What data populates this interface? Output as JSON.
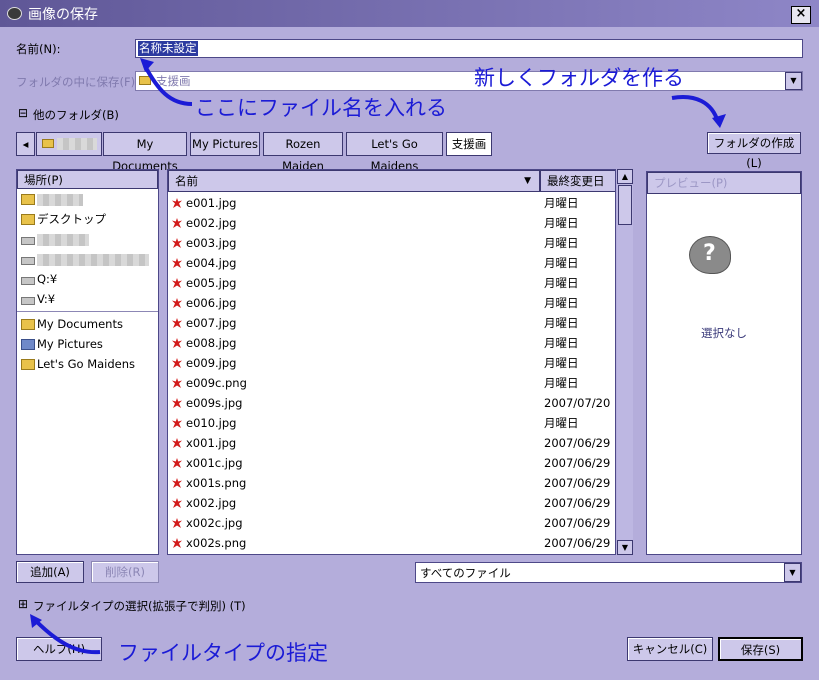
{
  "window": {
    "title": "画像の保存",
    "close": "×"
  },
  "name_row": {
    "label": "名前(N):",
    "value": "名称未設定"
  },
  "save_in": {
    "label": "フォルダの中に保存(F):",
    "value": "支援画"
  },
  "other_folders": {
    "toggle": "⊟",
    "label": "他のフォルダ(B)"
  },
  "breadcrumb": {
    "back": "◂",
    "items": [
      "My Documents",
      "My Pictures",
      "Rozen Maiden",
      "Let's Go Maidens",
      "支援画"
    ]
  },
  "create_folder_button": "フォルダの作成(L)",
  "places": {
    "header": "場所(P)",
    "items": [
      {
        "label": "",
        "icon": "folder-icon"
      },
      {
        "label": "デスクトップ",
        "icon": "folder-icon"
      },
      {
        "label": "",
        "icon": "drive-icon"
      },
      {
        "label": "",
        "icon": "drive-icon"
      },
      {
        "label": "Q:¥",
        "icon": "drive-icon"
      },
      {
        "label": "V:¥",
        "icon": "drive-icon"
      }
    ],
    "bookmarks": [
      {
        "label": "My Documents",
        "icon": "folder-icon"
      },
      {
        "label": "My Pictures",
        "icon": "pictures-folder-icon"
      },
      {
        "label": "Let's Go Maidens",
        "icon": "folder-icon"
      }
    ],
    "add_button": "追加(A)",
    "remove_button": "削除(R)"
  },
  "files": {
    "col_name": "名前",
    "col_modified": "最終変更日",
    "sort_arrow": "▼",
    "rows": [
      {
        "name": "e001.jpg",
        "modified": "月曜日"
      },
      {
        "name": "e002.jpg",
        "modified": "月曜日"
      },
      {
        "name": "e003.jpg",
        "modified": "月曜日"
      },
      {
        "name": "e004.jpg",
        "modified": "月曜日"
      },
      {
        "name": "e005.jpg",
        "modified": "月曜日"
      },
      {
        "name": "e006.jpg",
        "modified": "月曜日"
      },
      {
        "name": "e007.jpg",
        "modified": "月曜日"
      },
      {
        "name": "e008.jpg",
        "modified": "月曜日"
      },
      {
        "name": "e009.jpg",
        "modified": "月曜日"
      },
      {
        "name": "e009c.png",
        "modified": "月曜日"
      },
      {
        "name": "e009s.jpg",
        "modified": "2007/07/20"
      },
      {
        "name": "e010.jpg",
        "modified": "月曜日"
      },
      {
        "name": "x001.jpg",
        "modified": "2007/06/29"
      },
      {
        "name": "x001c.jpg",
        "modified": "2007/06/29"
      },
      {
        "name": "x001s.png",
        "modified": "2007/06/29"
      },
      {
        "name": "x002.jpg",
        "modified": "2007/06/29"
      },
      {
        "name": "x002c.jpg",
        "modified": "2007/06/29"
      },
      {
        "name": "x002s.png",
        "modified": "2007/06/29"
      }
    ],
    "filter": "すべてのファイル"
  },
  "preview": {
    "header": "プレビュー(P)",
    "empty_text": "選択なし",
    "icon": "question-mark-icon"
  },
  "file_type": {
    "toggle": "⊞",
    "label": "ファイルタイプの選択(拡張子で判別) (T)"
  },
  "buttons": {
    "help": "ヘルプ(H)",
    "cancel": "キャンセル(C)",
    "save": "保存(S)"
  },
  "annotations": {
    "filename": "ここにファイル名を入れる",
    "new_folder": "新しくフォルダを作る",
    "file_type": "ファイルタイプの指定",
    "color": "#1b1bd6"
  }
}
